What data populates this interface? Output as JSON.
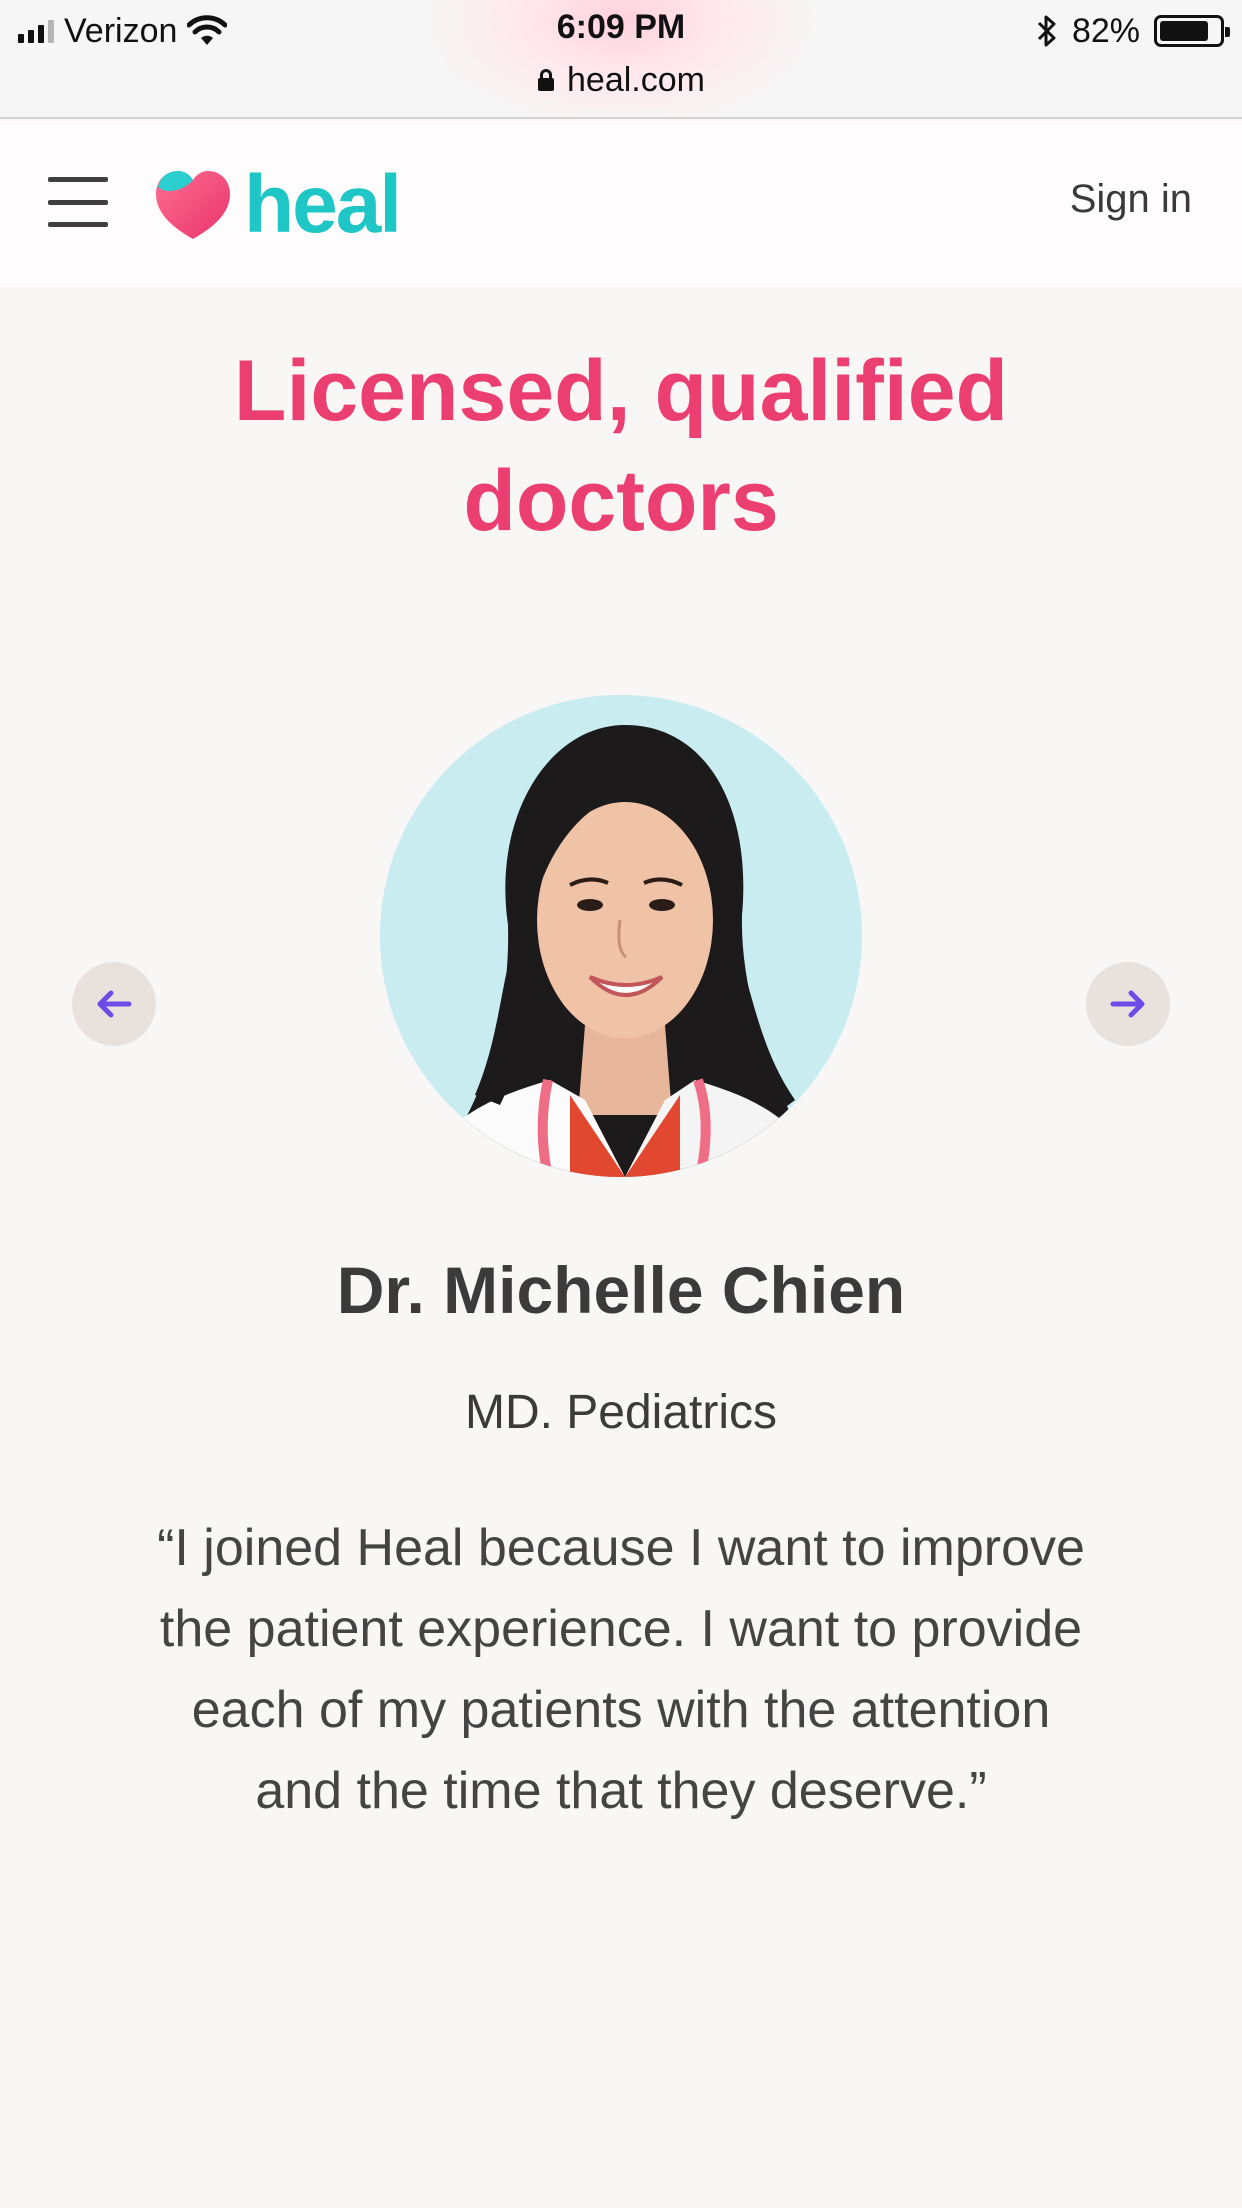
{
  "status_bar": {
    "carrier": "Verizon",
    "time": "6:09 PM",
    "battery": "82%",
    "battery_level": 0.82,
    "url": "heal.com"
  },
  "header": {
    "logo_text": "heal",
    "signin_label": "Sign in"
  },
  "content": {
    "headline": "Licensed, qualified doctors",
    "doctor": {
      "name": "Dr. Michelle Chien",
      "title": "MD. Pediatrics",
      "quote": "“I joined Heal because I want to improve the patient experience. I want to provide each of my patients with the attention and the time that they deserve.”"
    },
    "prev_icon": "arrow-left-icon",
    "next_icon": "arrow-right-icon"
  },
  "colors": {
    "brand_pink": "#ec3f71",
    "brand_teal": "#1fc6c6",
    "arrow_purple": "#6b4ce6",
    "arrow_bg": "#e9e2dc",
    "photo_bg": "#c9ecf0"
  }
}
